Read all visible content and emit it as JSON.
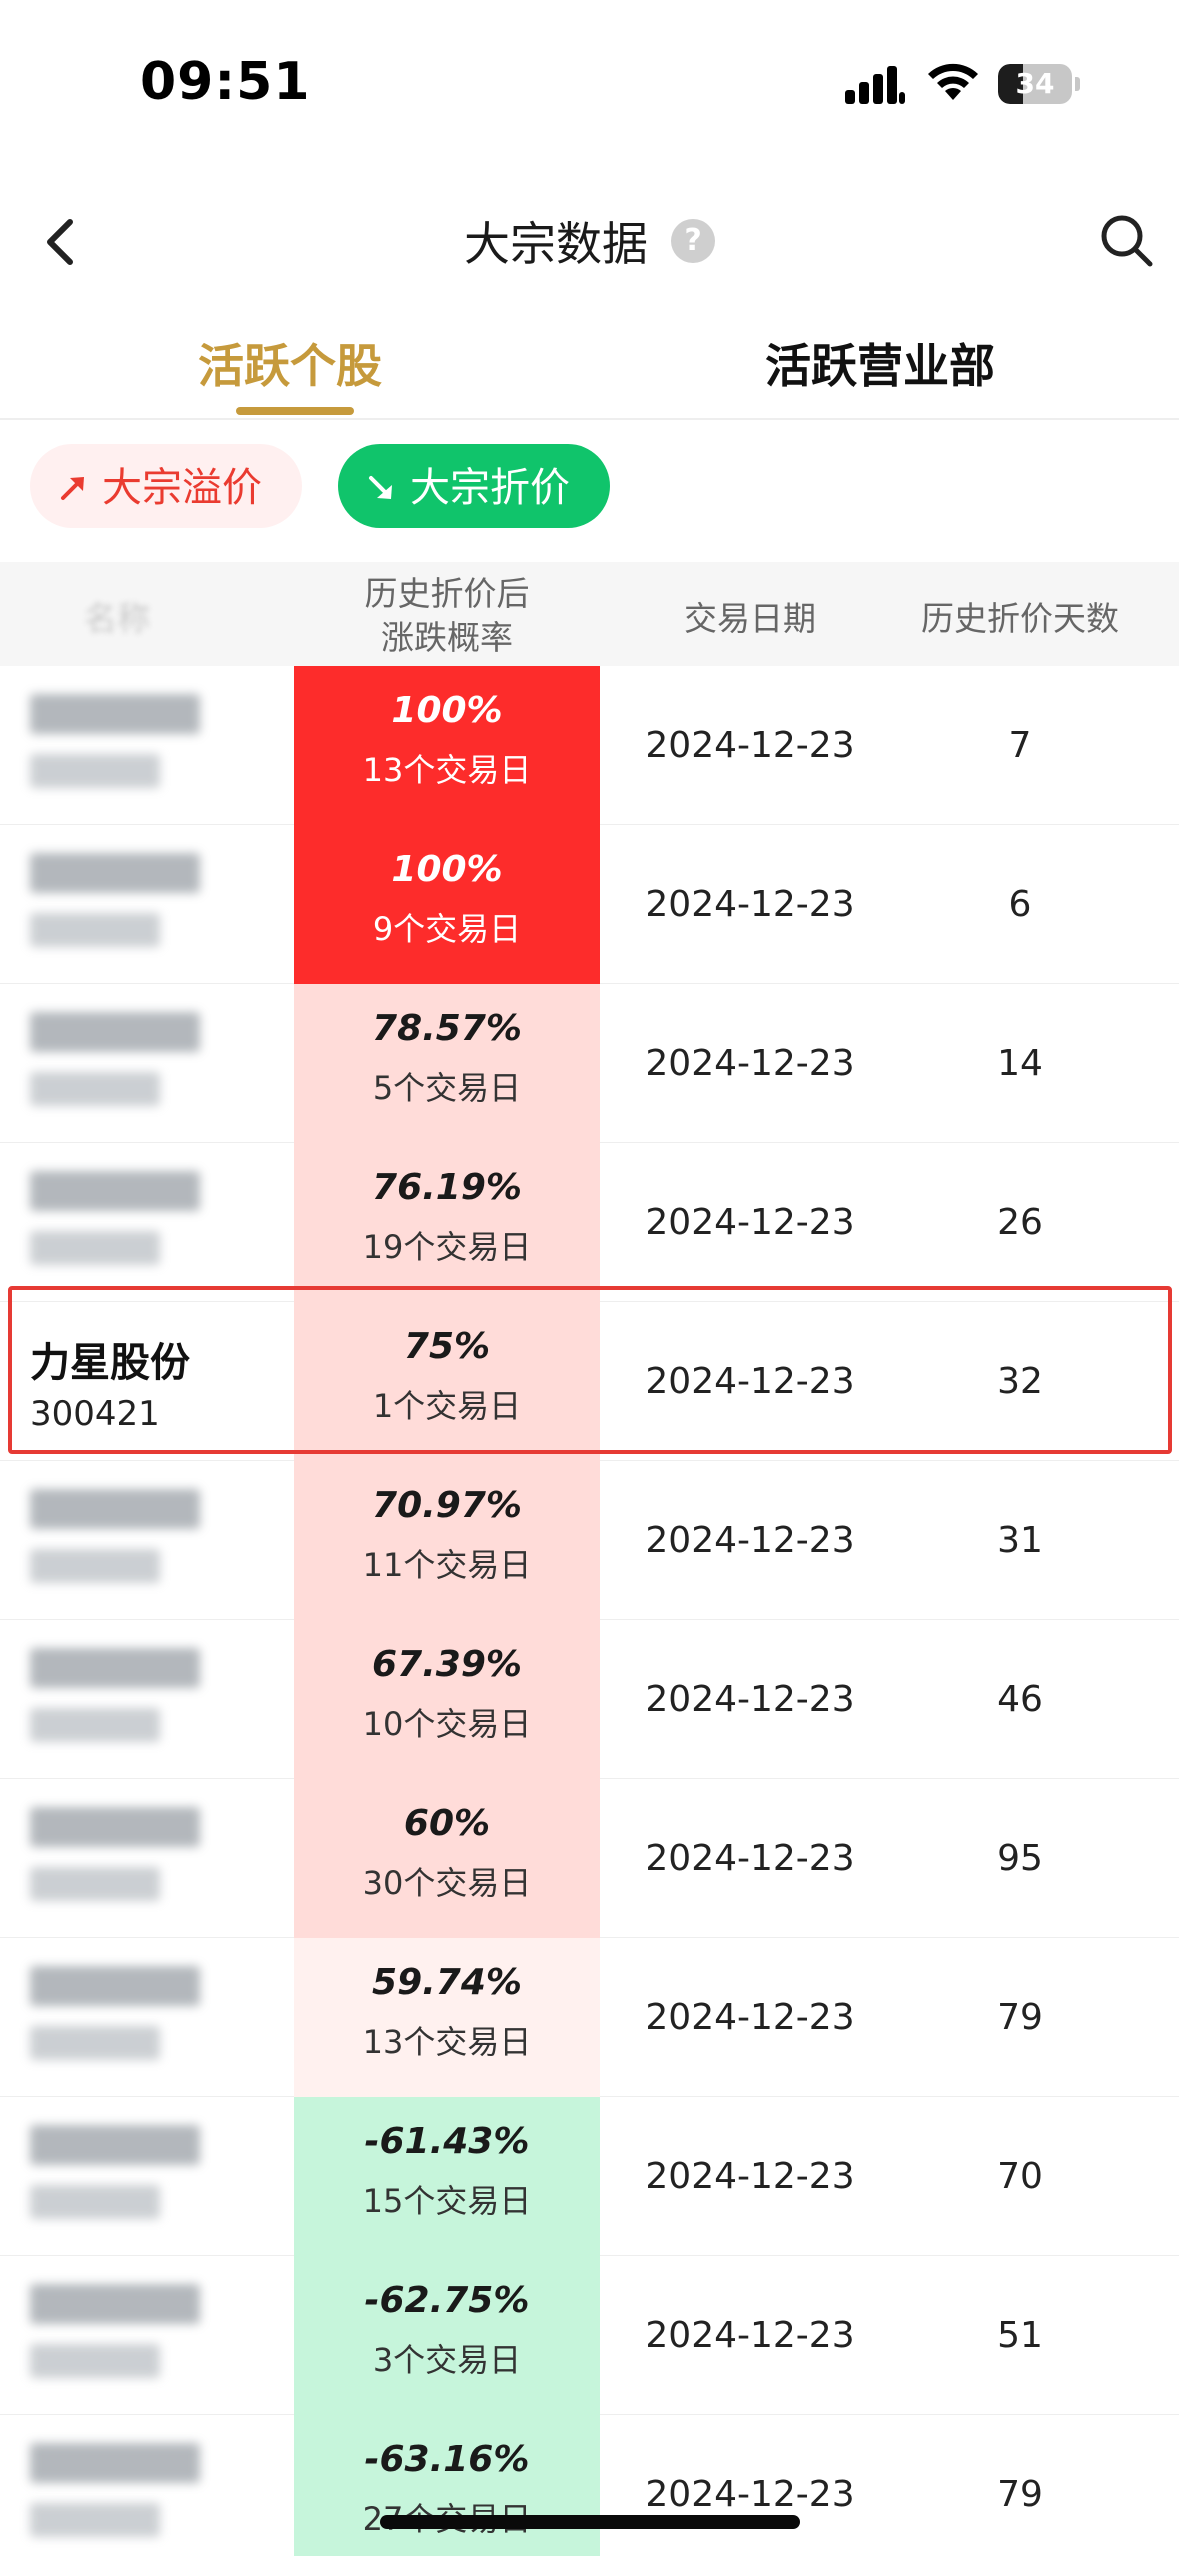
{
  "status_bar": {
    "time": "09:51",
    "battery": "34",
    "battery_level": 0.34
  },
  "nav": {
    "title": "大宗数据",
    "help_glyph": "?"
  },
  "tabs": [
    {
      "label": "活跃个股",
      "active": true
    },
    {
      "label": "活跃营业部",
      "active": false
    }
  ],
  "filters": {
    "premium_label": "大宗溢价",
    "discount_label": "大宗折价",
    "selected": "大宗折价"
  },
  "table": {
    "headers": {
      "name": "名称",
      "prob_line1": "历史折价后",
      "prob_line2": "涨跌概率",
      "date": "交易日期",
      "days": "历史折价天数"
    },
    "rows": [
      {
        "name": "",
        "code": "",
        "pct": "100%",
        "trade_days": "13个交易日",
        "date": "2024-12-23",
        "hist_days": "7",
        "bg": "#fd2c2b",
        "pct_color": "#ffffff",
        "blurred": true
      },
      {
        "name": "",
        "code": "",
        "pct": "100%",
        "trade_days": "9个交易日",
        "date": "2024-12-23",
        "hist_days": "6",
        "bg": "#fd2c2b",
        "pct_color": "#ffffff",
        "blurred": true
      },
      {
        "name": "",
        "code": "",
        "pct": "78.57%",
        "trade_days": "5个交易日",
        "date": "2024-12-23",
        "hist_days": "14",
        "bg": "#ffdcd9",
        "pct_color": "#1a1a1a",
        "blurred": true
      },
      {
        "name": "",
        "code": "",
        "pct": "76.19%",
        "trade_days": "19个交易日",
        "date": "2024-12-23",
        "hist_days": "26",
        "bg": "#ffdcd9",
        "pct_color": "#1a1a1a",
        "blurred": true
      },
      {
        "name": "力星股份",
        "code": "300421",
        "pct": "75%",
        "trade_days": "1个交易日",
        "date": "2024-12-23",
        "hist_days": "32",
        "bg": "#ffdcd9",
        "pct_color": "#1a1a1a",
        "blurred": false
      },
      {
        "name": "",
        "code": "",
        "pct": "70.97%",
        "trade_days": "11个交易日",
        "date": "2024-12-23",
        "hist_days": "31",
        "bg": "#ffdcd9",
        "pct_color": "#1a1a1a",
        "blurred": true
      },
      {
        "name": "",
        "code": "",
        "pct": "67.39%",
        "trade_days": "10个交易日",
        "date": "2024-12-23",
        "hist_days": "46",
        "bg": "#ffdcd9",
        "pct_color": "#1a1a1a",
        "blurred": true
      },
      {
        "name": "",
        "code": "",
        "pct": "60%",
        "trade_days": "30个交易日",
        "date": "2024-12-23",
        "hist_days": "95",
        "bg": "#ffdcd9",
        "pct_color": "#1a1a1a",
        "blurred": true
      },
      {
        "name": "",
        "code": "",
        "pct": "59.74%",
        "trade_days": "13个交易日",
        "date": "2024-12-23",
        "hist_days": "79",
        "bg": "#fff1ef",
        "pct_color": "#1a1a1a",
        "blurred": true
      },
      {
        "name": "",
        "code": "",
        "pct": "-61.43%",
        "trade_days": "15个交易日",
        "date": "2024-12-23",
        "hist_days": "70",
        "bg": "#c6f5db",
        "pct_color": "#1a1a1a",
        "blurred": true
      },
      {
        "name": "",
        "code": "",
        "pct": "-62.75%",
        "trade_days": "3个交易日",
        "date": "2024-12-23",
        "hist_days": "51",
        "bg": "#c6f5db",
        "pct_color": "#1a1a1a",
        "blurred": true
      },
      {
        "name": "",
        "code": "",
        "pct": "-63.16%",
        "trade_days": "27个交易日",
        "date": "2024-12-23",
        "hist_days": "79",
        "bg": "#c6f5db",
        "pct_color": "#1a1a1a",
        "blurred": true
      }
    ]
  },
  "colors": {
    "accent_gold": "#c69a3c",
    "rise_red": "#ea3b30",
    "fall_green": "#10c46b",
    "highlight_border": "#e63a34"
  }
}
